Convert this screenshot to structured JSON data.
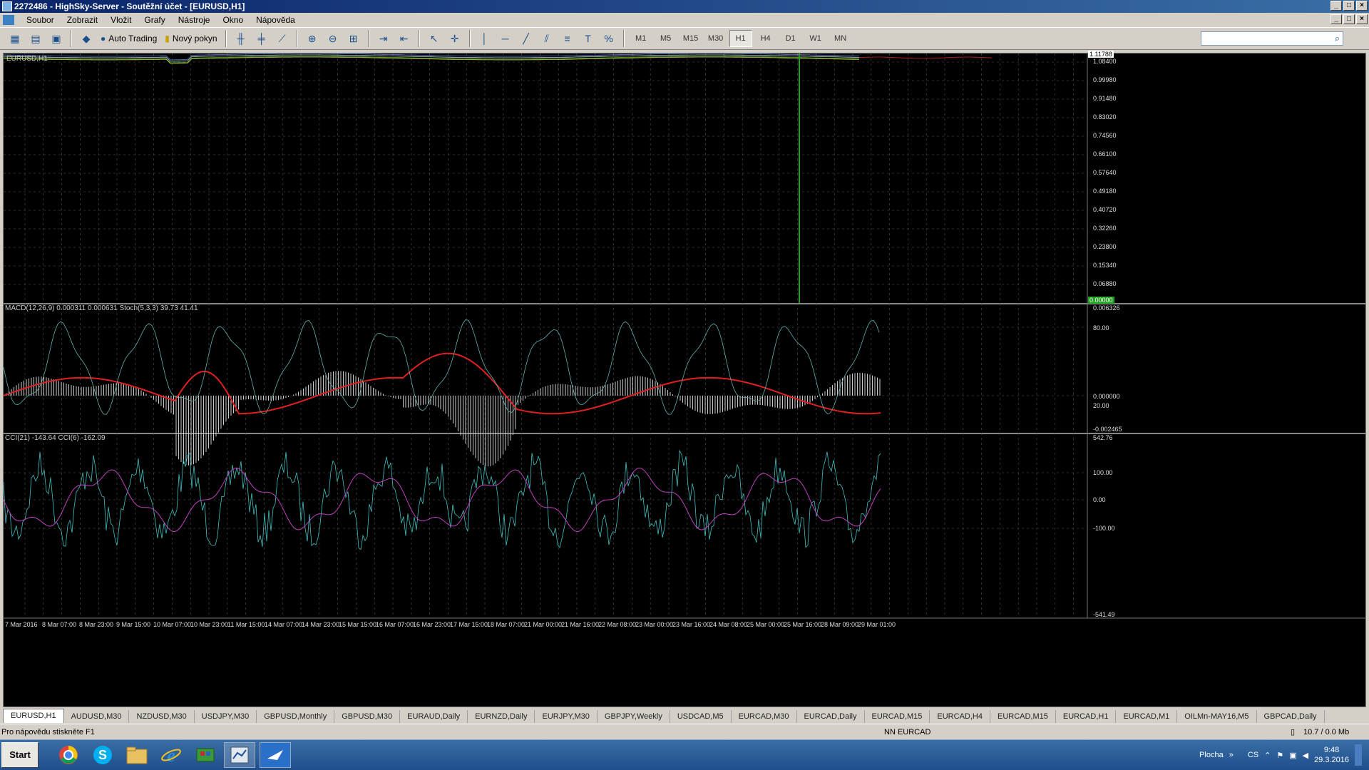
{
  "window": {
    "title": "2272486 - HighSky-Server - Soutěžní účet - [EURUSD,H1]"
  },
  "menu": [
    "Soubor",
    "Zobrazit",
    "Vložit",
    "Grafy",
    "Nástroje",
    "Okno",
    "Nápověda"
  ],
  "toolbar": {
    "auto_trading": "Auto Trading",
    "new_order": "Nový pokyn",
    "timeframes": [
      "M1",
      "M5",
      "M15",
      "M30",
      "H1",
      "H4",
      "D1",
      "W1",
      "MN"
    ],
    "active_timeframe": "H1"
  },
  "chart": {
    "symbol_label": "EURUSD,H1",
    "main_price_badge": "1.11788",
    "main_bottom_badge": "0.00000",
    "main_axis": [
      "1.08400",
      "0.99980",
      "0.91480",
      "0.83020",
      "0.74560",
      "0.66100",
      "0.57640",
      "0.49180",
      "0.40720",
      "0.32260",
      "0.23800",
      "0.15340",
      "0.06880"
    ],
    "macd_label": "MACD(12,26,9) 0.000311 0.000631 Stoch(5,3,3) 39.73 41.41",
    "macd_axis": [
      "0.006326",
      "80.00",
      "0.000000",
      "20.00",
      "-0.002465"
    ],
    "cci_label": "CCI(21) -143.64 CCI(6) -162.09",
    "cci_axis": [
      "542.76",
      "100.00",
      "0.00",
      "-100.00",
      "-541.49"
    ],
    "time_axis": [
      "7 Mar 2016",
      "8 Mar 07:00",
      "8 Mar 23:00",
      "9 Mar 15:00",
      "10 Mar 07:00",
      "10 Mar 23:00",
      "11 Mar 15:00",
      "14 Mar 07:00",
      "14 Mar 23:00",
      "15 Mar 15:00",
      "16 Mar 07:00",
      "16 Mar 23:00",
      "17 Mar 15:00",
      "18 Mar 07:00",
      "21 Mar 00:00",
      "21 Mar 16:00",
      "22 Mar 08:00",
      "23 Mar 00:00",
      "23 Mar 16:00",
      "24 Mar 08:00",
      "25 Mar 00:00",
      "25 Mar 16:00",
      "28 Mar 09:00",
      "29 Mar 01:00"
    ]
  },
  "tabs": [
    "EURUSD,H1",
    "AUDUSD,M30",
    "NZDUSD,M30",
    "USDJPY,M30",
    "GBPUSD,Monthly",
    "GBPUSD,M30",
    "EURAUD,Daily",
    "EURNZD,Daily",
    "EURJPY,M30",
    "GBPJPY,Weekly",
    "USDCAD,M5",
    "EURCAD,M30",
    "EURCAD,Daily",
    "EURCAD,M15",
    "EURCAD,H4",
    "EURCAD,M15",
    "EURCAD,H1",
    "EURCAD,M1",
    "OILMn-MAY16,M5",
    "GBPCAD,Daily"
  ],
  "status": {
    "help": "Pro nápovědu stiskněte F1",
    "profile": "NN EURCAD",
    "traffic": "10.7 / 0.0 Mb"
  },
  "taskbar": {
    "start": "Start",
    "desktop": "Plocha",
    "lang": "CS",
    "time": "9:48",
    "date": "29.3.2016"
  },
  "colors": {
    "macd_signal": "#e02020",
    "stoch": "#5fb0b0",
    "cci_fast": "#40c0c0",
    "cci_slow": "#c040c0",
    "vline": "#2a9a2a"
  }
}
